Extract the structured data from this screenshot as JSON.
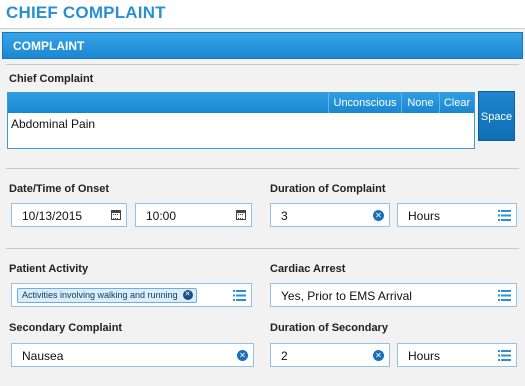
{
  "page_title": "CHIEF COMPLAINT",
  "panel": {
    "header": "COMPLAINT"
  },
  "chief_complaint": {
    "label": "Chief Complaint",
    "buttons": {
      "unconscious": "Unconscious",
      "none": "None",
      "clear": "Clear"
    },
    "value": "Abdominal Pain",
    "space_button": "Space"
  },
  "onset": {
    "label": "Date/Time of Onset",
    "date": "10/13/2015",
    "time": "10:00"
  },
  "duration_complaint": {
    "label": "Duration of Complaint",
    "value": "3",
    "unit": "Hours"
  },
  "patient_activity": {
    "label": "Patient Activity",
    "tag": "Activities involving walking and running"
  },
  "cardiac_arrest": {
    "label": "Cardiac Arrest",
    "value": "Yes, Prior to EMS Arrival"
  },
  "secondary_complaint": {
    "label": "Secondary Complaint",
    "value": "Nausea"
  },
  "duration_secondary": {
    "label": "Duration of Secondary",
    "value": "2",
    "unit": "Hours"
  },
  "icons": {
    "calendar": "calendar-icon",
    "clear": "clear-icon",
    "list": "list-icon"
  },
  "colors": {
    "accent": "#2b8fd6",
    "header": "#1b87d2",
    "button": "#1f86cf"
  }
}
